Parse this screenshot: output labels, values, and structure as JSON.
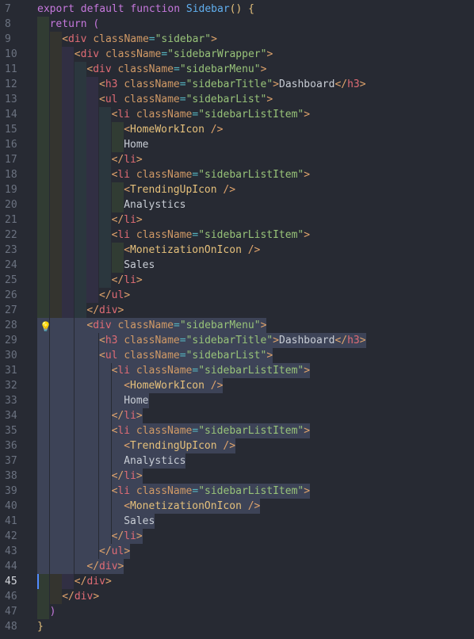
{
  "editor": {
    "active_line": 45,
    "lines": [
      {
        "num": 7,
        "indent": 0,
        "tokens": [
          [
            "kw",
            "export"
          ],
          [
            "text",
            " "
          ],
          [
            "kw",
            "default"
          ],
          [
            "text",
            " "
          ],
          [
            "kw",
            "function"
          ],
          [
            "text",
            " "
          ],
          [
            "fn",
            "Sidebar"
          ],
          [
            "br1",
            "()"
          ],
          [
            "text",
            " "
          ],
          [
            "br1",
            "{"
          ]
        ]
      },
      {
        "num": 8,
        "indent": 1,
        "tokens": [
          [
            "kw",
            "return"
          ],
          [
            "text",
            " "
          ],
          [
            "br2",
            "("
          ]
        ]
      },
      {
        "num": 9,
        "indent": 2,
        "tokens": [
          [
            "tag",
            "<"
          ],
          [
            "tagname",
            "div"
          ],
          [
            "text",
            " "
          ],
          [
            "attr",
            "className"
          ],
          [
            "op",
            "="
          ],
          [
            "str",
            "\"sidebar\""
          ],
          [
            "tag",
            ">"
          ]
        ]
      },
      {
        "num": 10,
        "indent": 3,
        "tokens": [
          [
            "tag",
            "<"
          ],
          [
            "tagname",
            "div"
          ],
          [
            "text",
            " "
          ],
          [
            "attr",
            "className"
          ],
          [
            "op",
            "="
          ],
          [
            "str",
            "\"sidebarWrapper\""
          ],
          [
            "tag",
            ">"
          ]
        ]
      },
      {
        "num": 11,
        "indent": 4,
        "tokens": [
          [
            "tag",
            "<"
          ],
          [
            "tagname",
            "div"
          ],
          [
            "text",
            " "
          ],
          [
            "attr",
            "className"
          ],
          [
            "op",
            "="
          ],
          [
            "str",
            "\"sidebarMenu\""
          ],
          [
            "tag",
            ">"
          ]
        ]
      },
      {
        "num": 12,
        "indent": 5,
        "tokens": [
          [
            "tag",
            "<"
          ],
          [
            "tagname",
            "h3"
          ],
          [
            "text",
            " "
          ],
          [
            "attr",
            "className"
          ],
          [
            "op",
            "="
          ],
          [
            "str",
            "\"sidebarTitle\""
          ],
          [
            "tag",
            ">"
          ],
          [
            "text",
            "Dashboard"
          ],
          [
            "tag",
            "</"
          ],
          [
            "tagname",
            "h3"
          ],
          [
            "tag",
            ">"
          ]
        ]
      },
      {
        "num": 13,
        "indent": 5,
        "tokens": [
          [
            "tag",
            "<"
          ],
          [
            "tagname",
            "ul"
          ],
          [
            "text",
            " "
          ],
          [
            "attr",
            "className"
          ],
          [
            "op",
            "="
          ],
          [
            "str",
            "\"sidebarList\""
          ],
          [
            "tag",
            ">"
          ]
        ]
      },
      {
        "num": 14,
        "indent": 6,
        "tokens": [
          [
            "tag",
            "<"
          ],
          [
            "tagname",
            "li"
          ],
          [
            "text",
            " "
          ],
          [
            "attr",
            "className"
          ],
          [
            "op",
            "="
          ],
          [
            "str",
            "\"sidebarListItem\""
          ],
          [
            "tag",
            ">"
          ]
        ]
      },
      {
        "num": 15,
        "indent": 7,
        "tokens": [
          [
            "tag",
            "<"
          ],
          [
            "comp",
            "HomeWorkIcon"
          ],
          [
            "text",
            " "
          ],
          [
            "tag",
            "/>"
          ]
        ]
      },
      {
        "num": 16,
        "indent": 7,
        "tokens": [
          [
            "text",
            "Home"
          ]
        ]
      },
      {
        "num": 17,
        "indent": 6,
        "tokens": [
          [
            "tag",
            "</"
          ],
          [
            "tagname",
            "li"
          ],
          [
            "tag",
            ">"
          ]
        ]
      },
      {
        "num": 18,
        "indent": 6,
        "tokens": [
          [
            "tag",
            "<"
          ],
          [
            "tagname",
            "li"
          ],
          [
            "text",
            " "
          ],
          [
            "attr",
            "className"
          ],
          [
            "op",
            "="
          ],
          [
            "str",
            "\"sidebarListItem\""
          ],
          [
            "tag",
            ">"
          ]
        ]
      },
      {
        "num": 19,
        "indent": 7,
        "tokens": [
          [
            "tag",
            "<"
          ],
          [
            "comp",
            "TrendingUpIcon"
          ],
          [
            "text",
            " "
          ],
          [
            "tag",
            "/>"
          ]
        ]
      },
      {
        "num": 20,
        "indent": 7,
        "tokens": [
          [
            "text",
            "Analystics"
          ]
        ]
      },
      {
        "num": 21,
        "indent": 6,
        "tokens": [
          [
            "tag",
            "</"
          ],
          [
            "tagname",
            "li"
          ],
          [
            "tag",
            ">"
          ]
        ]
      },
      {
        "num": 22,
        "indent": 6,
        "tokens": [
          [
            "tag",
            "<"
          ],
          [
            "tagname",
            "li"
          ],
          [
            "text",
            " "
          ],
          [
            "attr",
            "className"
          ],
          [
            "op",
            "="
          ],
          [
            "str",
            "\"sidebarListItem\""
          ],
          [
            "tag",
            ">"
          ]
        ]
      },
      {
        "num": 23,
        "indent": 7,
        "tokens": [
          [
            "tag",
            "<"
          ],
          [
            "comp",
            "MonetizationOnIcon"
          ],
          [
            "text",
            " "
          ],
          [
            "tag",
            "/>"
          ]
        ]
      },
      {
        "num": 24,
        "indent": 7,
        "tokens": [
          [
            "text",
            "Sales"
          ]
        ]
      },
      {
        "num": 25,
        "indent": 6,
        "tokens": [
          [
            "tag",
            "</"
          ],
          [
            "tagname",
            "li"
          ],
          [
            "tag",
            ">"
          ]
        ]
      },
      {
        "num": 26,
        "indent": 5,
        "tokens": [
          [
            "tag",
            "</"
          ],
          [
            "tagname",
            "ul"
          ],
          [
            "tag",
            ">"
          ]
        ]
      },
      {
        "num": 27,
        "indent": 4,
        "tokens": [
          [
            "tag",
            "</"
          ],
          [
            "tagname",
            "div"
          ],
          [
            "tag",
            ">"
          ]
        ]
      },
      {
        "num": 28,
        "indent": 4,
        "sel": true,
        "bulb": true,
        "tokens": [
          [
            "tag",
            "<"
          ],
          [
            "tagname",
            "div"
          ],
          [
            "text",
            " "
          ],
          [
            "attr",
            "className"
          ],
          [
            "op",
            "="
          ],
          [
            "str",
            "\"sidebarMenu\""
          ],
          [
            "tag",
            ">"
          ]
        ]
      },
      {
        "num": 29,
        "indent": 5,
        "sel": true,
        "tokens": [
          [
            "tag",
            "<"
          ],
          [
            "tagname",
            "h3"
          ],
          [
            "text",
            " "
          ],
          [
            "attr",
            "className"
          ],
          [
            "op",
            "="
          ],
          [
            "str",
            "\"sidebarTitle\""
          ],
          [
            "tag",
            ">"
          ],
          [
            "text",
            "Dashboard"
          ],
          [
            "tag",
            "</"
          ],
          [
            "tagname",
            "h3"
          ],
          [
            "tag",
            ">"
          ]
        ]
      },
      {
        "num": 30,
        "indent": 5,
        "sel": true,
        "tokens": [
          [
            "tag",
            "<"
          ],
          [
            "tagname",
            "ul"
          ],
          [
            "text",
            " "
          ],
          [
            "attr",
            "className"
          ],
          [
            "op",
            "="
          ],
          [
            "str",
            "\"sidebarList\""
          ],
          [
            "tag",
            ">"
          ]
        ]
      },
      {
        "num": 31,
        "indent": 6,
        "sel": true,
        "tokens": [
          [
            "tag",
            "<"
          ],
          [
            "tagname",
            "li"
          ],
          [
            "text",
            " "
          ],
          [
            "attr",
            "className"
          ],
          [
            "op",
            "="
          ],
          [
            "str",
            "\"sidebarListItem\""
          ],
          [
            "tag",
            ">"
          ]
        ]
      },
      {
        "num": 32,
        "indent": 7,
        "sel": true,
        "tokens": [
          [
            "tag",
            "<"
          ],
          [
            "comp",
            "HomeWorkIcon"
          ],
          [
            "text",
            " "
          ],
          [
            "tag",
            "/>"
          ]
        ]
      },
      {
        "num": 33,
        "indent": 7,
        "sel": true,
        "tokens": [
          [
            "text",
            "Home"
          ]
        ]
      },
      {
        "num": 34,
        "indent": 6,
        "sel": true,
        "tokens": [
          [
            "tag",
            "</"
          ],
          [
            "tagname",
            "li"
          ],
          [
            "tag",
            ">"
          ]
        ]
      },
      {
        "num": 35,
        "indent": 6,
        "sel": true,
        "tokens": [
          [
            "tag",
            "<"
          ],
          [
            "tagname",
            "li"
          ],
          [
            "text",
            " "
          ],
          [
            "attr",
            "className"
          ],
          [
            "op",
            "="
          ],
          [
            "str",
            "\"sidebarListItem\""
          ],
          [
            "tag",
            ">"
          ]
        ]
      },
      {
        "num": 36,
        "indent": 7,
        "sel": true,
        "tokens": [
          [
            "tag",
            "<"
          ],
          [
            "comp",
            "TrendingUpIcon"
          ],
          [
            "text",
            " "
          ],
          [
            "tag",
            "/>"
          ]
        ]
      },
      {
        "num": 37,
        "indent": 7,
        "sel": true,
        "tokens": [
          [
            "text",
            "Analystics"
          ]
        ]
      },
      {
        "num": 38,
        "indent": 6,
        "sel": true,
        "tokens": [
          [
            "tag",
            "</"
          ],
          [
            "tagname",
            "li"
          ],
          [
            "tag",
            ">"
          ]
        ]
      },
      {
        "num": 39,
        "indent": 6,
        "sel": true,
        "tokens": [
          [
            "tag",
            "<"
          ],
          [
            "tagname",
            "li"
          ],
          [
            "text",
            " "
          ],
          [
            "attr",
            "className"
          ],
          [
            "op",
            "="
          ],
          [
            "str",
            "\"sidebarListItem\""
          ],
          [
            "tag",
            ">"
          ]
        ]
      },
      {
        "num": 40,
        "indent": 7,
        "sel": true,
        "tokens": [
          [
            "tag",
            "<"
          ],
          [
            "comp",
            "MonetizationOnIcon"
          ],
          [
            "text",
            " "
          ],
          [
            "tag",
            "/>"
          ]
        ]
      },
      {
        "num": 41,
        "indent": 7,
        "sel": true,
        "tokens": [
          [
            "text",
            "Sales"
          ]
        ]
      },
      {
        "num": 42,
        "indent": 6,
        "sel": true,
        "tokens": [
          [
            "tag",
            "</"
          ],
          [
            "tagname",
            "li"
          ],
          [
            "tag",
            ">"
          ]
        ]
      },
      {
        "num": 43,
        "indent": 5,
        "sel": true,
        "tokens": [
          [
            "tag",
            "</"
          ],
          [
            "tagname",
            "ul"
          ],
          [
            "tag",
            ">"
          ]
        ]
      },
      {
        "num": 44,
        "indent": 4,
        "sel": true,
        "tokens": [
          [
            "tag",
            "</"
          ],
          [
            "tagname",
            "div"
          ],
          [
            "tag",
            ">"
          ]
        ]
      },
      {
        "num": 45,
        "indent": 3,
        "cursor": true,
        "tokens": [
          [
            "tag",
            "</"
          ],
          [
            "tagname",
            "div"
          ],
          [
            "tag",
            ">"
          ]
        ]
      },
      {
        "num": 46,
        "indent": 2,
        "tokens": [
          [
            "tag",
            "</"
          ],
          [
            "tagname",
            "div"
          ],
          [
            "tag",
            ">"
          ]
        ]
      },
      {
        "num": 47,
        "indent": 1,
        "tokens": [
          [
            "br2",
            ")"
          ]
        ]
      },
      {
        "num": 48,
        "indent": 0,
        "tokens": [
          [
            "br1",
            "}"
          ]
        ]
      }
    ]
  }
}
